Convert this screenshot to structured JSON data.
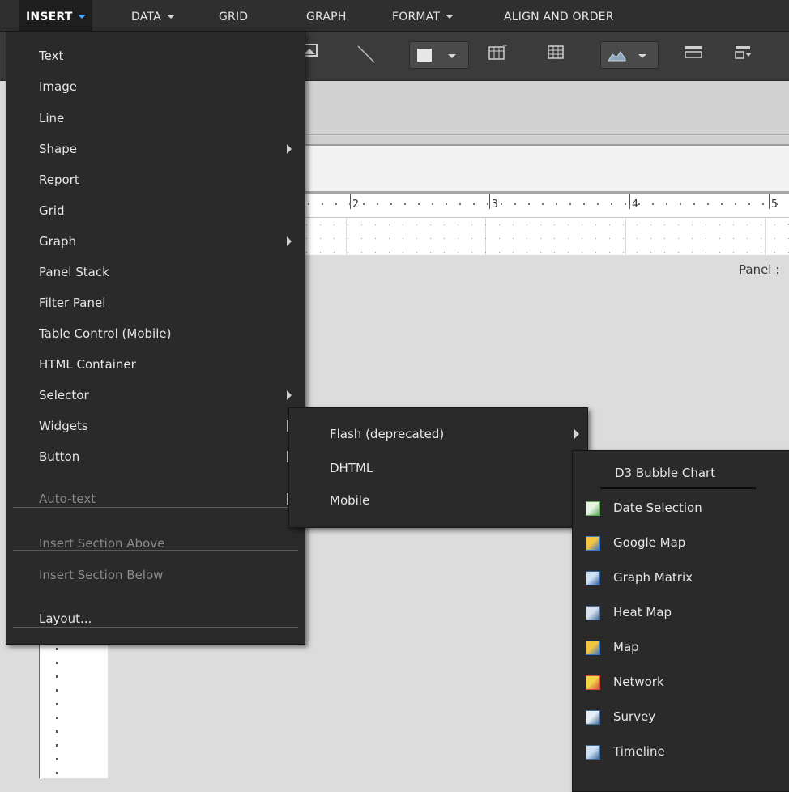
{
  "menubar": {
    "items": [
      {
        "label": "INSERT",
        "has_dropdown": true,
        "active": true
      },
      {
        "label": "DATA",
        "has_dropdown": true
      },
      {
        "label": "GRID",
        "has_dropdown": false
      },
      {
        "label": "GRAPH",
        "has_dropdown": false
      },
      {
        "label": "FORMAT",
        "has_dropdown": true
      },
      {
        "label": "ALIGN AND ORDER",
        "has_dropdown": false
      }
    ]
  },
  "ruler": {
    "numbers": [
      "2",
      "3",
      "4",
      "5"
    ]
  },
  "canvas": {
    "panel_label": "Panel :"
  },
  "insert_menu": {
    "items": [
      {
        "label": "Text",
        "submenu": false,
        "disabled": false
      },
      {
        "label": "Image",
        "submenu": false,
        "disabled": false
      },
      {
        "label": "Line",
        "submenu": false,
        "disabled": false
      },
      {
        "label": "Shape",
        "submenu": true,
        "disabled": false
      },
      {
        "label": "Report",
        "submenu": false,
        "disabled": false
      },
      {
        "label": "Grid",
        "submenu": false,
        "disabled": false
      },
      {
        "label": "Graph",
        "submenu": true,
        "disabled": false
      },
      {
        "label": "Panel Stack",
        "submenu": false,
        "disabled": false
      },
      {
        "label": "Filter Panel",
        "submenu": false,
        "disabled": false
      },
      {
        "label": "Table Control (Mobile)",
        "submenu": false,
        "disabled": false
      },
      {
        "label": "HTML Container",
        "submenu": false,
        "disabled": false
      },
      {
        "label": "Selector",
        "submenu": true,
        "disabled": false
      },
      {
        "label": "Widgets",
        "submenu": true,
        "disabled": false
      },
      {
        "label": "Button",
        "submenu": true,
        "disabled": false
      },
      {
        "label": "Auto-text",
        "submenu": true,
        "disabled": true
      },
      {
        "label": "Insert Section Above",
        "submenu": false,
        "disabled": true
      },
      {
        "label": "Insert Section Below",
        "submenu": false,
        "disabled": true
      },
      {
        "label": "Layout...",
        "submenu": false,
        "disabled": false
      }
    ]
  },
  "widgets_menu": {
    "items": [
      {
        "label": "Flash (deprecated)",
        "submenu": true
      },
      {
        "label": "DHTML",
        "submenu": true
      },
      {
        "label": "Mobile",
        "submenu": false
      }
    ]
  },
  "dhtml_menu": {
    "items": [
      {
        "label": "D3 Bubble Chart",
        "icon": "none",
        "highlighted": true
      },
      {
        "label": "Date Selection",
        "icon": "date-selection-icon"
      },
      {
        "label": "Google Map",
        "icon": "google-map-icon"
      },
      {
        "label": "Graph Matrix",
        "icon": "graph-matrix-icon"
      },
      {
        "label": "Heat Map",
        "icon": "heat-map-icon"
      },
      {
        "label": "Map",
        "icon": "map-icon"
      },
      {
        "label": "Network",
        "icon": "network-icon"
      },
      {
        "label": "Survey",
        "icon": "survey-icon"
      },
      {
        "label": "Timeline",
        "icon": "timeline-icon"
      }
    ]
  },
  "colors": {
    "menu_bg": "#2a2a2a",
    "menubar_bg": "#2f2f2f",
    "accent_caret": "#4aa8ff"
  }
}
